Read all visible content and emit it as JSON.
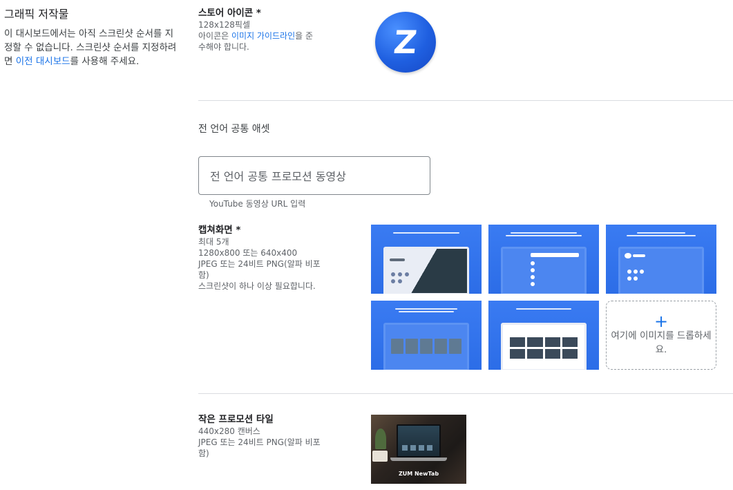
{
  "left": {
    "title": "그래픽 저작물",
    "desc_before": "이 대시보드에서는 아직 스크린샷 순서를 지정할 수 없습니다. 스크린샷 순서를 지정하려면 ",
    "desc_link": "이전 대시보드",
    "desc_after": "를 사용해 주세요."
  },
  "store_icon": {
    "title": "스토어 아이콘 *",
    "size": "128x128픽셀",
    "desc_before": "아이콘은 ",
    "desc_link": "이미지 가이드라인",
    "desc_after": "을 준수해야 합니다.",
    "letter": "Z",
    "accent": "#1f5fe0"
  },
  "shared_assets": {
    "title": "전 언어 공통 애셋",
    "promo_video_placeholder": "전 언어 공통 프로모션 동영상",
    "promo_video_hint": "YouTube 동영상 URL 입력"
  },
  "screenshots": {
    "title": "캡쳐화면 *",
    "lines": [
      "최대 5개",
      "1280x800 또는 640x400",
      "JPEG 또는 24비트 PNG(알파 비포함)",
      "스크린샷이 하나 이상 필요합니다."
    ],
    "thumb_color": "#2c6de7",
    "drop_text": "여기에 이미지를 드롭하세요.",
    "drop_icon": "plus-icon"
  },
  "small_tile": {
    "title": "작은 프로모션 타일",
    "lines": [
      "440x280 캔버스",
      "JPEG 또는 24비트 PNG(알파 비포함)"
    ],
    "caption": "ZUM NewTab"
  }
}
